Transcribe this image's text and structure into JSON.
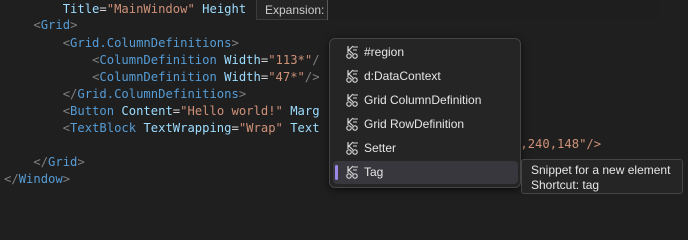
{
  "editor": {
    "lines": [
      {
        "name": "line-title",
        "segments": [
          {
            "c": "tag-bracket",
            "t": "        "
          },
          {
            "c": "attr-name",
            "t": "Title"
          },
          {
            "c": "text",
            "t": "="
          },
          {
            "c": "attr-val",
            "t": "\"MainWindow\""
          },
          {
            "c": "text",
            "t": " "
          },
          {
            "c": "attr-name",
            "t": "Height"
          }
        ]
      },
      {
        "name": "line-grid-open",
        "segments": [
          {
            "c": "text",
            "t": "    "
          },
          {
            "c": "tag-bracket",
            "t": "<"
          },
          {
            "c": "tag-name",
            "t": "Grid"
          },
          {
            "c": "tag-bracket",
            "t": ">"
          }
        ]
      },
      {
        "name": "line-coldefs-open",
        "segments": [
          {
            "c": "text",
            "t": "        "
          },
          {
            "c": "tag-bracket",
            "t": "<"
          },
          {
            "c": "tag-name",
            "t": "Grid.ColumnDefinitions"
          },
          {
            "c": "tag-bracket",
            "t": ">"
          }
        ]
      },
      {
        "name": "line-coldef-1",
        "segments": [
          {
            "c": "text",
            "t": "            "
          },
          {
            "c": "tag-bracket",
            "t": "<"
          },
          {
            "c": "tag-name",
            "t": "ColumnDefinition"
          },
          {
            "c": "text",
            "t": " "
          },
          {
            "c": "attr-name",
            "t": "Width"
          },
          {
            "c": "text",
            "t": "="
          },
          {
            "c": "attr-val",
            "t": "\"113*\""
          },
          {
            "c": "tag-bracket",
            "t": "/"
          }
        ]
      },
      {
        "name": "line-coldef-2",
        "segments": [
          {
            "c": "text",
            "t": "            "
          },
          {
            "c": "tag-bracket",
            "t": "<"
          },
          {
            "c": "tag-name",
            "t": "ColumnDefinition"
          },
          {
            "c": "text",
            "t": " "
          },
          {
            "c": "attr-name",
            "t": "Width"
          },
          {
            "c": "text",
            "t": "="
          },
          {
            "c": "attr-val",
            "t": "\"47*\""
          },
          {
            "c": "tag-bracket",
            "t": "/>"
          }
        ]
      },
      {
        "name": "line-coldefs-close",
        "segments": [
          {
            "c": "text",
            "t": "        "
          },
          {
            "c": "tag-bracket",
            "t": "</"
          },
          {
            "c": "tag-name",
            "t": "Grid.ColumnDefinitions"
          },
          {
            "c": "tag-bracket",
            "t": ">"
          }
        ]
      },
      {
        "name": "line-button",
        "segments": [
          {
            "c": "text",
            "t": "        "
          },
          {
            "c": "tag-bracket",
            "t": "<"
          },
          {
            "c": "tag-name",
            "t": "Button"
          },
          {
            "c": "text",
            "t": " "
          },
          {
            "c": "attr-name",
            "t": "Content"
          },
          {
            "c": "text",
            "t": "="
          },
          {
            "c": "attr-val",
            "t": "\"Hello world!\""
          },
          {
            "c": "text",
            "t": " "
          },
          {
            "c": "attr-name",
            "t": "Marg"
          }
        ]
      },
      {
        "name": "line-textblock",
        "segments": [
          {
            "c": "text",
            "t": "        "
          },
          {
            "c": "tag-bracket",
            "t": "<"
          },
          {
            "c": "tag-name",
            "t": "TextBlock"
          },
          {
            "c": "text",
            "t": " "
          },
          {
            "c": "attr-name",
            "t": "TextWrapping"
          },
          {
            "c": "text",
            "t": "="
          },
          {
            "c": "attr-val",
            "t": "\"Wrap\""
          },
          {
            "c": "text",
            "t": " "
          },
          {
            "c": "attr-name",
            "t": "Text"
          }
        ]
      },
      {
        "name": "line-blank",
        "segments": []
      },
      {
        "name": "line-grid-close",
        "segments": [
          {
            "c": "text",
            "t": "    "
          },
          {
            "c": "tag-bracket",
            "t": "</"
          },
          {
            "c": "tag-name",
            "t": "Grid"
          },
          {
            "c": "tag-bracket",
            "t": ">"
          }
        ]
      },
      {
        "name": "line-window-close",
        "segments": [
          {
            "c": "tag-bracket",
            "t": "</"
          },
          {
            "c": "tag-name",
            "t": "Window"
          },
          {
            "c": "tag-bracket",
            "t": ">"
          }
        ]
      }
    ],
    "textblock_tail": "255,240,148\"/>"
  },
  "expansion": {
    "label": "Expansion:",
    "value": ""
  },
  "completion": {
    "items": [
      {
        "label": "#region",
        "icon": "snippet-icon"
      },
      {
        "label": "d:DataContext",
        "icon": "snippet-icon"
      },
      {
        "label": "Grid ColumnDefinition",
        "icon": "snippet-icon"
      },
      {
        "label": "Grid RowDefinition",
        "icon": "snippet-icon"
      },
      {
        "label": "Setter",
        "icon": "snippet-icon"
      },
      {
        "label": "Tag",
        "icon": "snippet-icon",
        "selected": true
      }
    ]
  },
  "tooltip": {
    "line1": "Snippet for a new element",
    "line2": "Shortcut: tag"
  },
  "colors": {
    "background": "#1f1f1f",
    "tag": "#569cd6",
    "attribute": "#9cdcfe",
    "string": "#ce9178",
    "selection_accent": "#9b88e8"
  }
}
